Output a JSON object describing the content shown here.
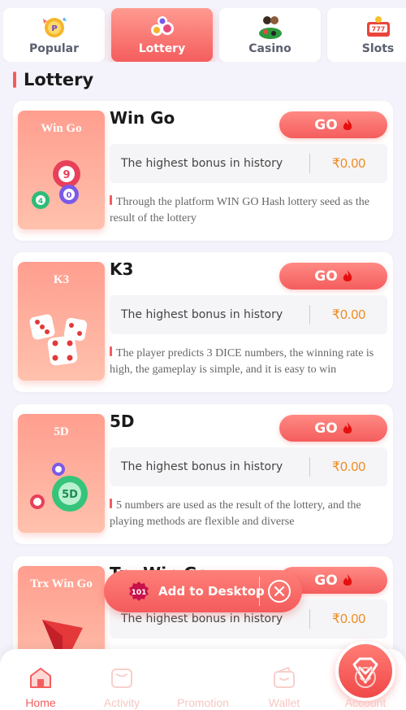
{
  "tabs": [
    {
      "label": "Popular",
      "icon": "popular-icon"
    },
    {
      "label": "Lottery",
      "icon": "lottery-icon",
      "active": true
    },
    {
      "label": "Casino",
      "icon": "casino-icon"
    },
    {
      "label": "Slots",
      "icon": "slots-icon"
    }
  ],
  "section": {
    "title": "Lottery"
  },
  "games": [
    {
      "title": "Win Go",
      "image_label": "Win Go",
      "go_label": "GO",
      "bonus_label": "The highest bonus in history",
      "bonus_value": "₹0.00",
      "description": "Through the platform WIN GO Hash lottery seed as the result of the lottery"
    },
    {
      "title": "K3",
      "image_label": "K3",
      "go_label": "GO",
      "bonus_label": "The highest bonus in history",
      "bonus_value": "₹0.00",
      "description": "The player predicts 3 DICE numbers, the winning rate is high, the gameplay is simple, and it is easy to win"
    },
    {
      "title": "5D",
      "image_label": "5D",
      "go_label": "GO",
      "bonus_label": "The highest bonus in history",
      "bonus_value": "₹0.00",
      "description": "5 numbers are used as the result of the lottery, and the playing methods are flexible and diverse"
    },
    {
      "title": "Trx Win Go",
      "image_label": "Trx Win Go",
      "go_label": "GO",
      "bonus_label": "The highest bonus in history",
      "bonus_value": "₹0.00",
      "description": ""
    }
  ],
  "popup": {
    "text": "Add to Desktop",
    "logo_text": "101"
  },
  "nav": [
    {
      "label": "Home",
      "icon": "home-icon",
      "active": true
    },
    {
      "label": "Activity",
      "icon": "activity-icon"
    },
    {
      "label": "Promotion",
      "icon": "promotion-icon"
    },
    {
      "label": "Wallet",
      "icon": "wallet-icon"
    },
    {
      "label": "Account",
      "icon": "account-icon"
    }
  ],
  "colors": {
    "accent": "#f45d5d",
    "bonus_value": "#f08a1e",
    "background": "#f4f3fb"
  }
}
